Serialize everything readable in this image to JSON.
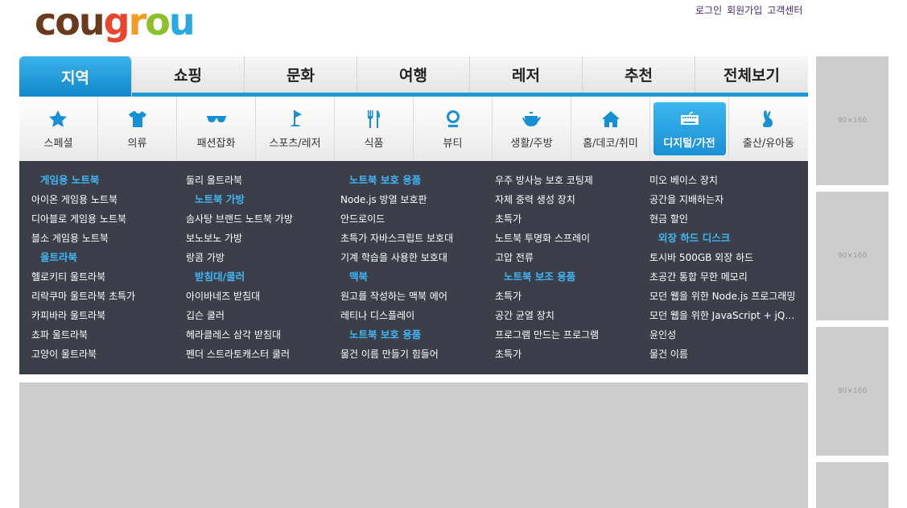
{
  "logo": {
    "parts": [
      "cou",
      "g",
      "r",
      "o",
      "u"
    ]
  },
  "top_links": [
    "로그인",
    "회원가입",
    "고객센터"
  ],
  "main_tabs": [
    {
      "label": "지역",
      "active": true
    },
    {
      "label": "쇼핑"
    },
    {
      "label": "문화"
    },
    {
      "label": "여행"
    },
    {
      "label": "레저"
    },
    {
      "label": "추천"
    },
    {
      "label": "전체보기"
    }
  ],
  "categories": [
    {
      "label": "스페셜",
      "icon": "star-icon"
    },
    {
      "label": "의류",
      "icon": "shirt-icon"
    },
    {
      "label": "패션잡화",
      "icon": "sunglasses-icon"
    },
    {
      "label": "스포츠/레저",
      "icon": "golf-flag-icon"
    },
    {
      "label": "식품",
      "icon": "fork-knife-icon"
    },
    {
      "label": "뷰티",
      "icon": "mirror-icon"
    },
    {
      "label": "생활/주방",
      "icon": "teapot-icon"
    },
    {
      "label": "홈/데코/취미",
      "icon": "house-icon"
    },
    {
      "label": "디지털/가전",
      "icon": "keyboard-icon",
      "active": true
    },
    {
      "label": "출산/유아동",
      "icon": "rabbit-icon"
    }
  ],
  "menu_columns": [
    [
      {
        "text": "게임용 노트북",
        "head": true
      },
      {
        "text": "아이온 게임용 노트북"
      },
      {
        "text": "디아블로 게임용 노트북"
      },
      {
        "text": "블소 게임용 노트북"
      },
      {
        "text": "울트라북",
        "head": true
      },
      {
        "text": "헬로키티 울트라북"
      },
      {
        "text": "리락쿠마 울트라북 초특가"
      },
      {
        "text": "카피바라 울트라북"
      },
      {
        "text": "쵸파 울트라북"
      },
      {
        "text": "고양이 울트라북"
      }
    ],
    [
      {
        "text": "둘리 울트라북"
      },
      {
        "text": "노트북 가방",
        "head": true
      },
      {
        "text": "솜사탕 브랜드 노트북 가방"
      },
      {
        "text": "보노보노 가방"
      },
      {
        "text": "랑콤 가방"
      },
      {
        "text": "받침대/쿨러",
        "head": true
      },
      {
        "text": "아이바네즈 받침대"
      },
      {
        "text": "깁슨 쿨러"
      },
      {
        "text": "헤라클레스 삼각 받침대"
      },
      {
        "text": "펜더 스트라토캐스터 쿨러"
      }
    ],
    [
      {
        "text": "노트북 보호 용품",
        "head": true
      },
      {
        "text": "Node.js 방열 보호판"
      },
      {
        "text": "안드로이드"
      },
      {
        "text": "초특가 자바스크립트 보호대"
      },
      {
        "text": "기계 학습을 사용한 보호대"
      },
      {
        "text": "맥북",
        "head": true
      },
      {
        "text": "원고를 작성하는 맥북 에어"
      },
      {
        "text": "레티나 디스플레이"
      },
      {
        "text": "노트북 보호 용품",
        "head": true
      },
      {
        "text": "물건 이름 만들기 힘들어"
      }
    ],
    [
      {
        "text": "우주 방사능 보호 코팅제"
      },
      {
        "text": "자체 중력 생성 장치"
      },
      {
        "text": "초특가"
      },
      {
        "text": "노트북 투명화 스프레이"
      },
      {
        "text": "고압 전류"
      },
      {
        "text": "노트북 보조 용품",
        "head": true
      },
      {
        "text": "초특가"
      },
      {
        "text": "공간 균열 장치"
      },
      {
        "text": "프로그램 만드는 프로그램"
      },
      {
        "text": "초특가"
      }
    ],
    [
      {
        "text": "미오 베이스 장치"
      },
      {
        "text": "공간을 지배하는자"
      },
      {
        "text": "현금 할인"
      },
      {
        "text": "외장 하드 디스크",
        "head": true
      },
      {
        "text": "토시바 500GB 외장 하드"
      },
      {
        "text": "초공간 통합 무한 메모리"
      },
      {
        "text": "모던 웹을 위한 Node.js 프로그래밍"
      },
      {
        "text": "모던 웹을 위한 JavaScript + jQuery 입문"
      },
      {
        "text": "윤인성"
      },
      {
        "text": "물건 이름"
      }
    ]
  ],
  "ads": [
    "90×160",
    "90×160",
    "90×160",
    ""
  ],
  "colors": {
    "accent": "#1c9ad8",
    "panel_bg": "#3a3f4a",
    "head_text": "#42b6f4"
  }
}
